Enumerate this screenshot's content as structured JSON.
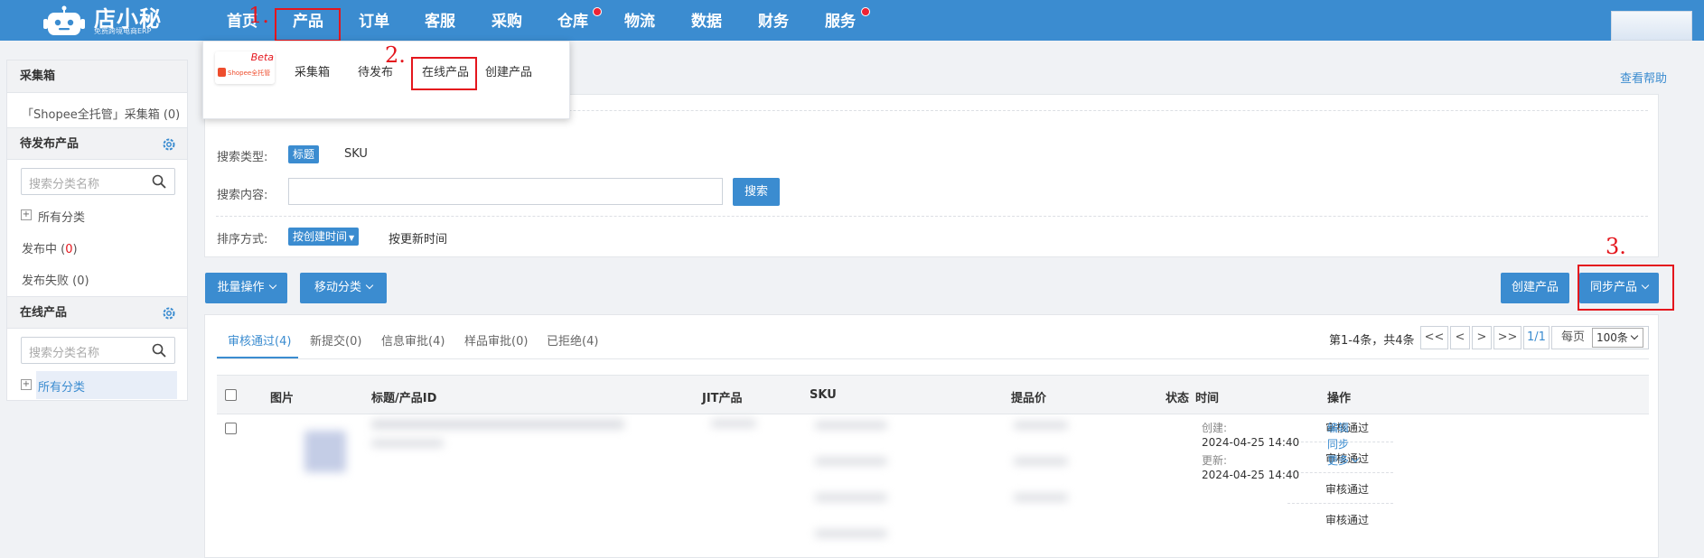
{
  "brand": {
    "name": "店小秘",
    "subtitle": "免费跨境电商ERP"
  },
  "nav": {
    "items": [
      "首页",
      "产品",
      "订单",
      "客服",
      "采购",
      "仓库",
      "物流",
      "数据",
      "财务",
      "服务"
    ],
    "dots_on": [
      "仓库",
      "服务"
    ]
  },
  "annotations": {
    "n1": "1.",
    "n2": "2.",
    "n3": "3."
  },
  "dropdown": {
    "beta_badge": "Beta",
    "shopee_logo_text": "Shopee全托管",
    "items": [
      "采集箱",
      "待发布",
      "在线产品",
      "创建产品"
    ]
  },
  "sidebar": {
    "collect_title": "采集箱",
    "collect_item": "「Shopee全托管」采集箱 (0)",
    "pending_title": "待发布产品",
    "pending_search_placeholder": "搜索分类名称",
    "pending_all": "所有分类",
    "publishing_label": "发布中 (",
    "publishing_count": "0",
    "publishing_close": ")",
    "failed": "发布失败 (0)",
    "online_title": "在线产品",
    "online_search_placeholder": "搜索分类名称",
    "online_all": "所有分类"
  },
  "help": "查看帮助",
  "filters": {
    "search_type_label": "搜索类型:",
    "search_type_selected": "标题",
    "search_type_other": "SKU",
    "content_label": "搜索内容:",
    "search_button": "搜索",
    "sort_label": "排序方式:",
    "sort_selected": "按创建时间",
    "sort_other": "按更新时间"
  },
  "actions": {
    "batch": "批量操作",
    "move": "移动分类",
    "create": "创建产品",
    "sync": "同步产品"
  },
  "tabs": [
    "审核通过(4)",
    "新提交(0)",
    "信息审批(4)",
    "样品审批(0)",
    "已拒绝(4)"
  ],
  "pager": {
    "summary": "第1-4条，共4条",
    "first": "<<",
    "prev": "<",
    "next": ">",
    "last": ">>",
    "page": "1/1",
    "per_page_label": "每页",
    "per_page": "100条"
  },
  "table": {
    "headers": [
      "图片",
      "标题/产品ID",
      "JIT产品",
      "SKU",
      "提品价",
      "状态",
      "时间",
      "操作"
    ],
    "row": {
      "statuses": [
        "审核通过",
        "审核通过",
        "审核通过",
        "审核通过"
      ],
      "created_label": "创建:",
      "created": "2024-04-25 14:40",
      "updated_label": "更新:",
      "updated": "2024-04-25 14:40",
      "ops": [
        "编辑",
        "同步",
        "更多"
      ]
    }
  },
  "colors": {
    "primary": "#3b8cd0",
    "annotation": "#e4161d"
  }
}
